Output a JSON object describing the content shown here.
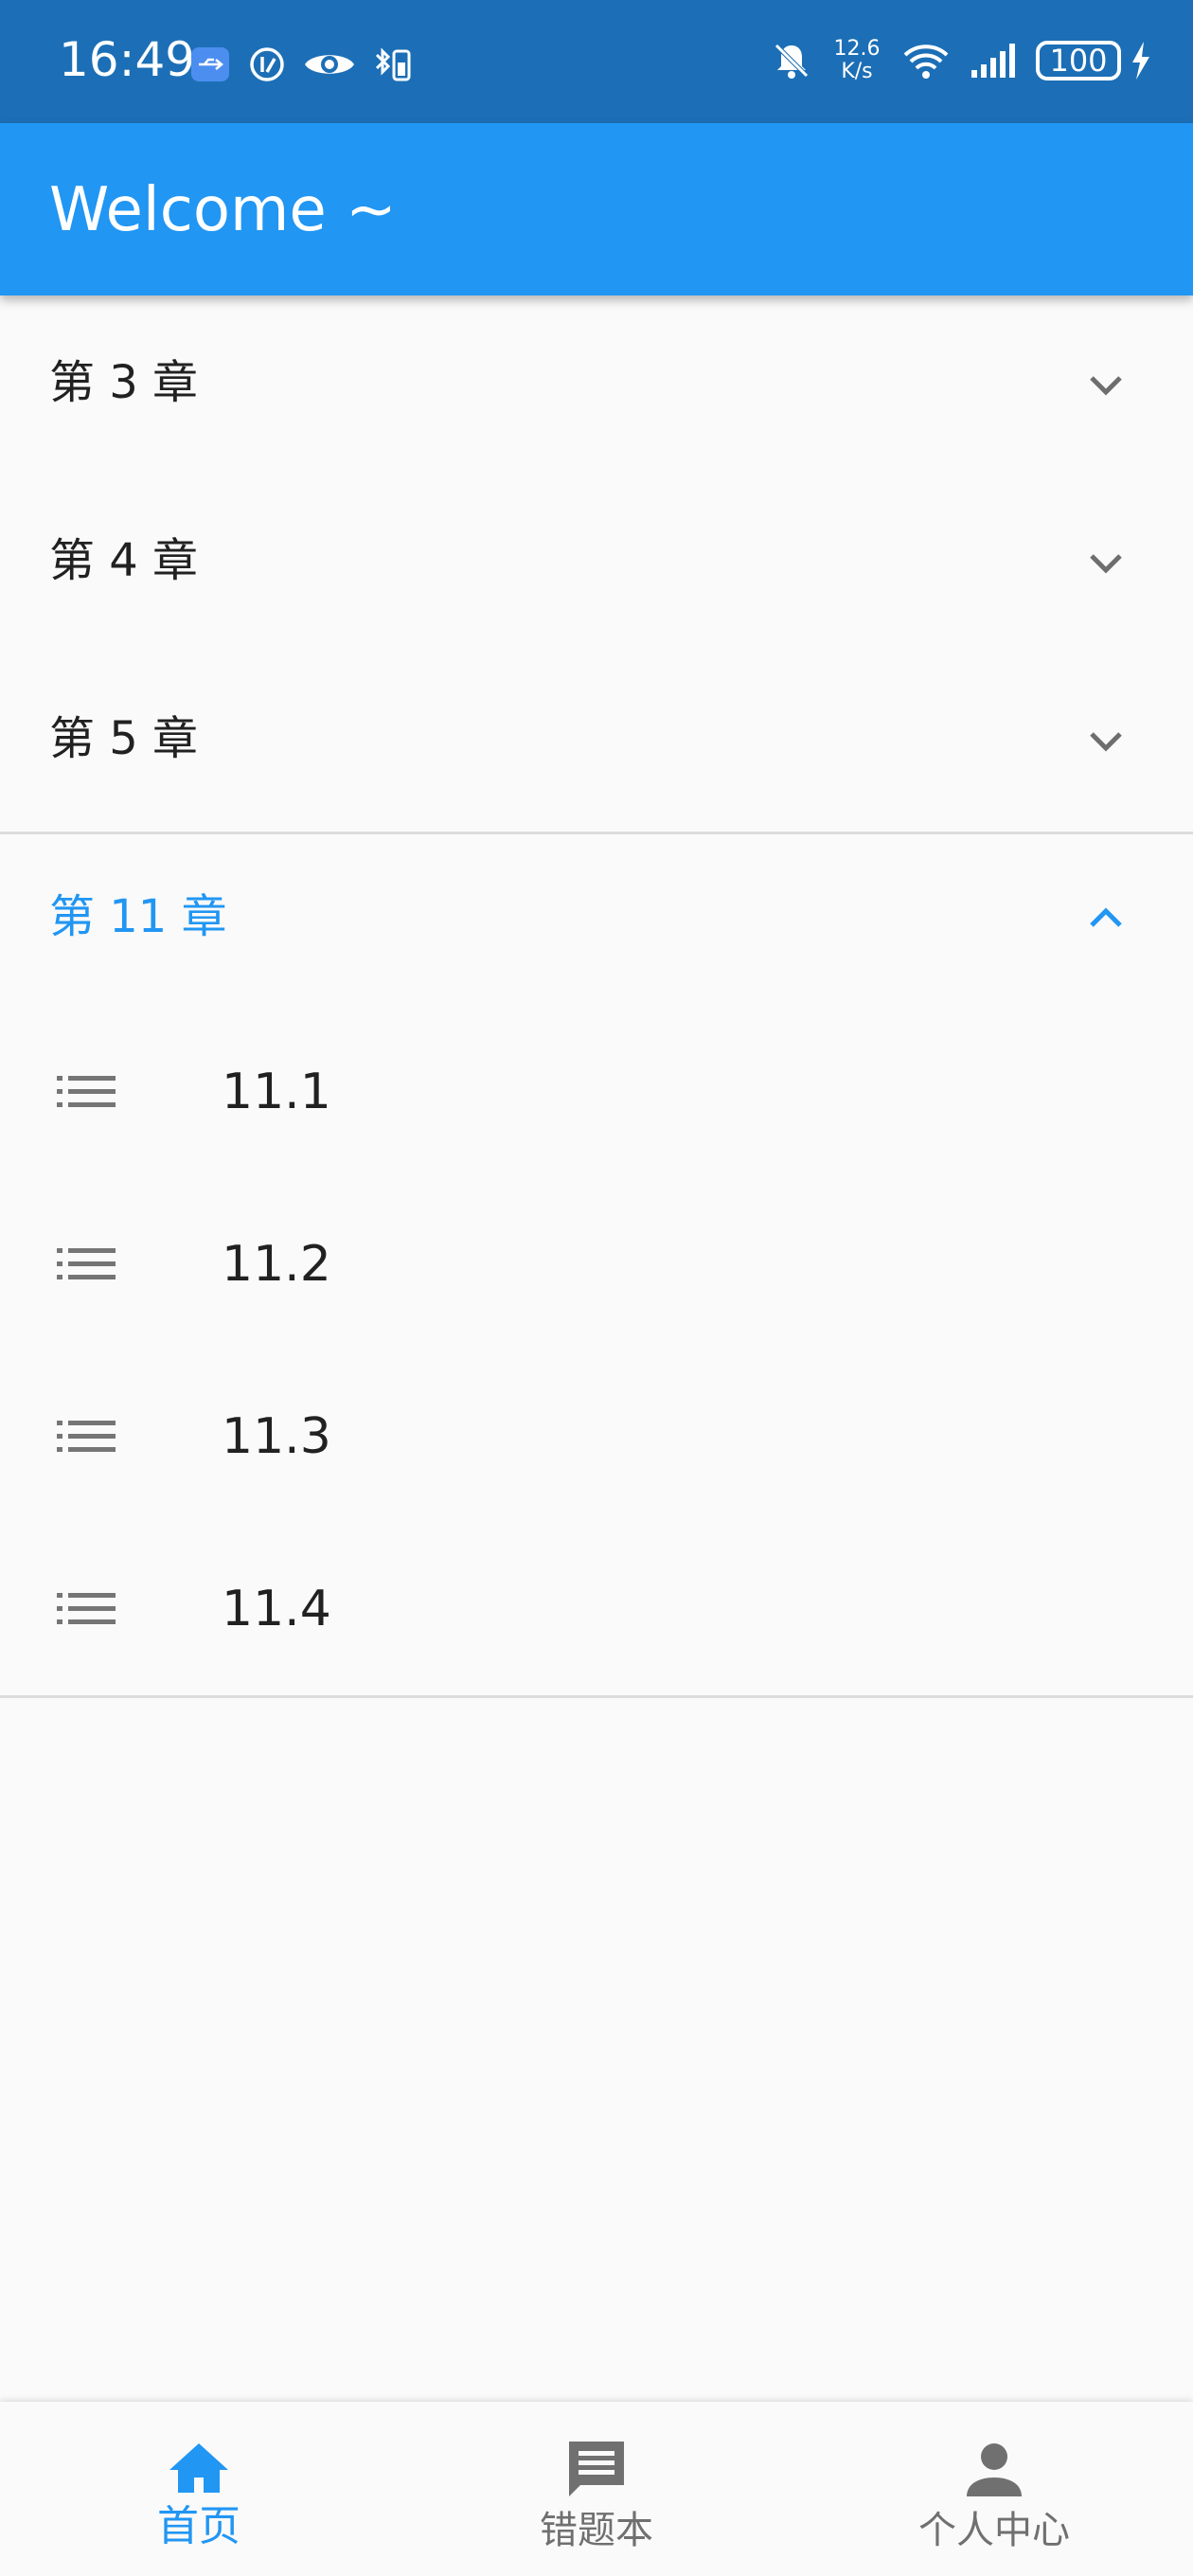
{
  "status_bar": {
    "time": "16:49",
    "net_speed_value": "12.6",
    "net_speed_unit": "K/s",
    "battery": "100",
    "icons_left": [
      "usb-icon",
      "data-saver-icon",
      "eye-icon",
      "bluetooth-battery-icon"
    ],
    "icons_right": [
      "bell-off-icon",
      "net-speed",
      "wifi-icon",
      "signal-icon",
      "battery-icon",
      "charging-icon"
    ]
  },
  "app_bar": {
    "title": "Welcome ~"
  },
  "chapters": [
    {
      "label": "第 3 章",
      "expanded": false
    },
    {
      "label": "第 4 章",
      "expanded": false
    },
    {
      "label": "第 5 章",
      "expanded": false
    },
    {
      "label": "第 11 章",
      "expanded": true
    }
  ],
  "sections": [
    {
      "label": "11.1"
    },
    {
      "label": "11.2"
    },
    {
      "label": "11.3"
    },
    {
      "label": "11.4"
    }
  ],
  "bottom_nav": {
    "items": [
      {
        "label": "首页",
        "icon": "home-icon",
        "active": true
      },
      {
        "label": "错题本",
        "icon": "message-icon",
        "active": false
      },
      {
        "label": "个人中心",
        "icon": "person-icon",
        "active": false
      }
    ]
  },
  "colors": {
    "status_bar": "#1c6fb6",
    "app_bar": "#2196f3",
    "accent": "#2196f3",
    "inactive": "#707070",
    "background": "#fafafa"
  }
}
